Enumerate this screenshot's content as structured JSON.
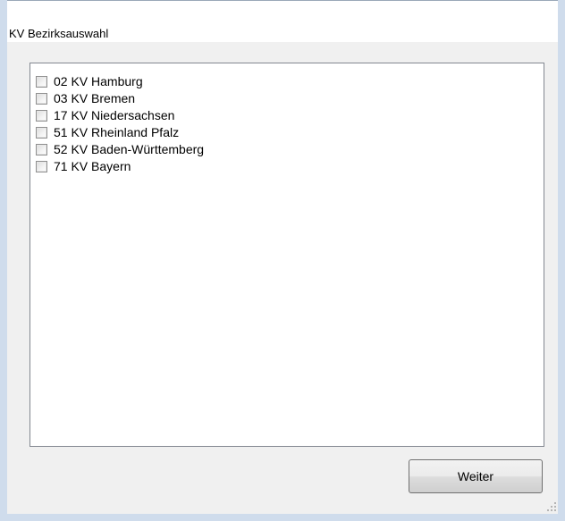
{
  "window": {
    "title": "KV Bezirksauswahl"
  },
  "list": {
    "items": [
      {
        "label": "02 KV Hamburg",
        "checked": false
      },
      {
        "label": "03 KV Bremen",
        "checked": false
      },
      {
        "label": "17 KV Niedersachsen",
        "checked": false
      },
      {
        "label": "51 KV Rheinland Pfalz",
        "checked": false
      },
      {
        "label": "52 KV Baden-Württemberg",
        "checked": false
      },
      {
        "label": "71 KV Bayern",
        "checked": false
      }
    ]
  },
  "buttons": {
    "next_label": "Weiter"
  }
}
